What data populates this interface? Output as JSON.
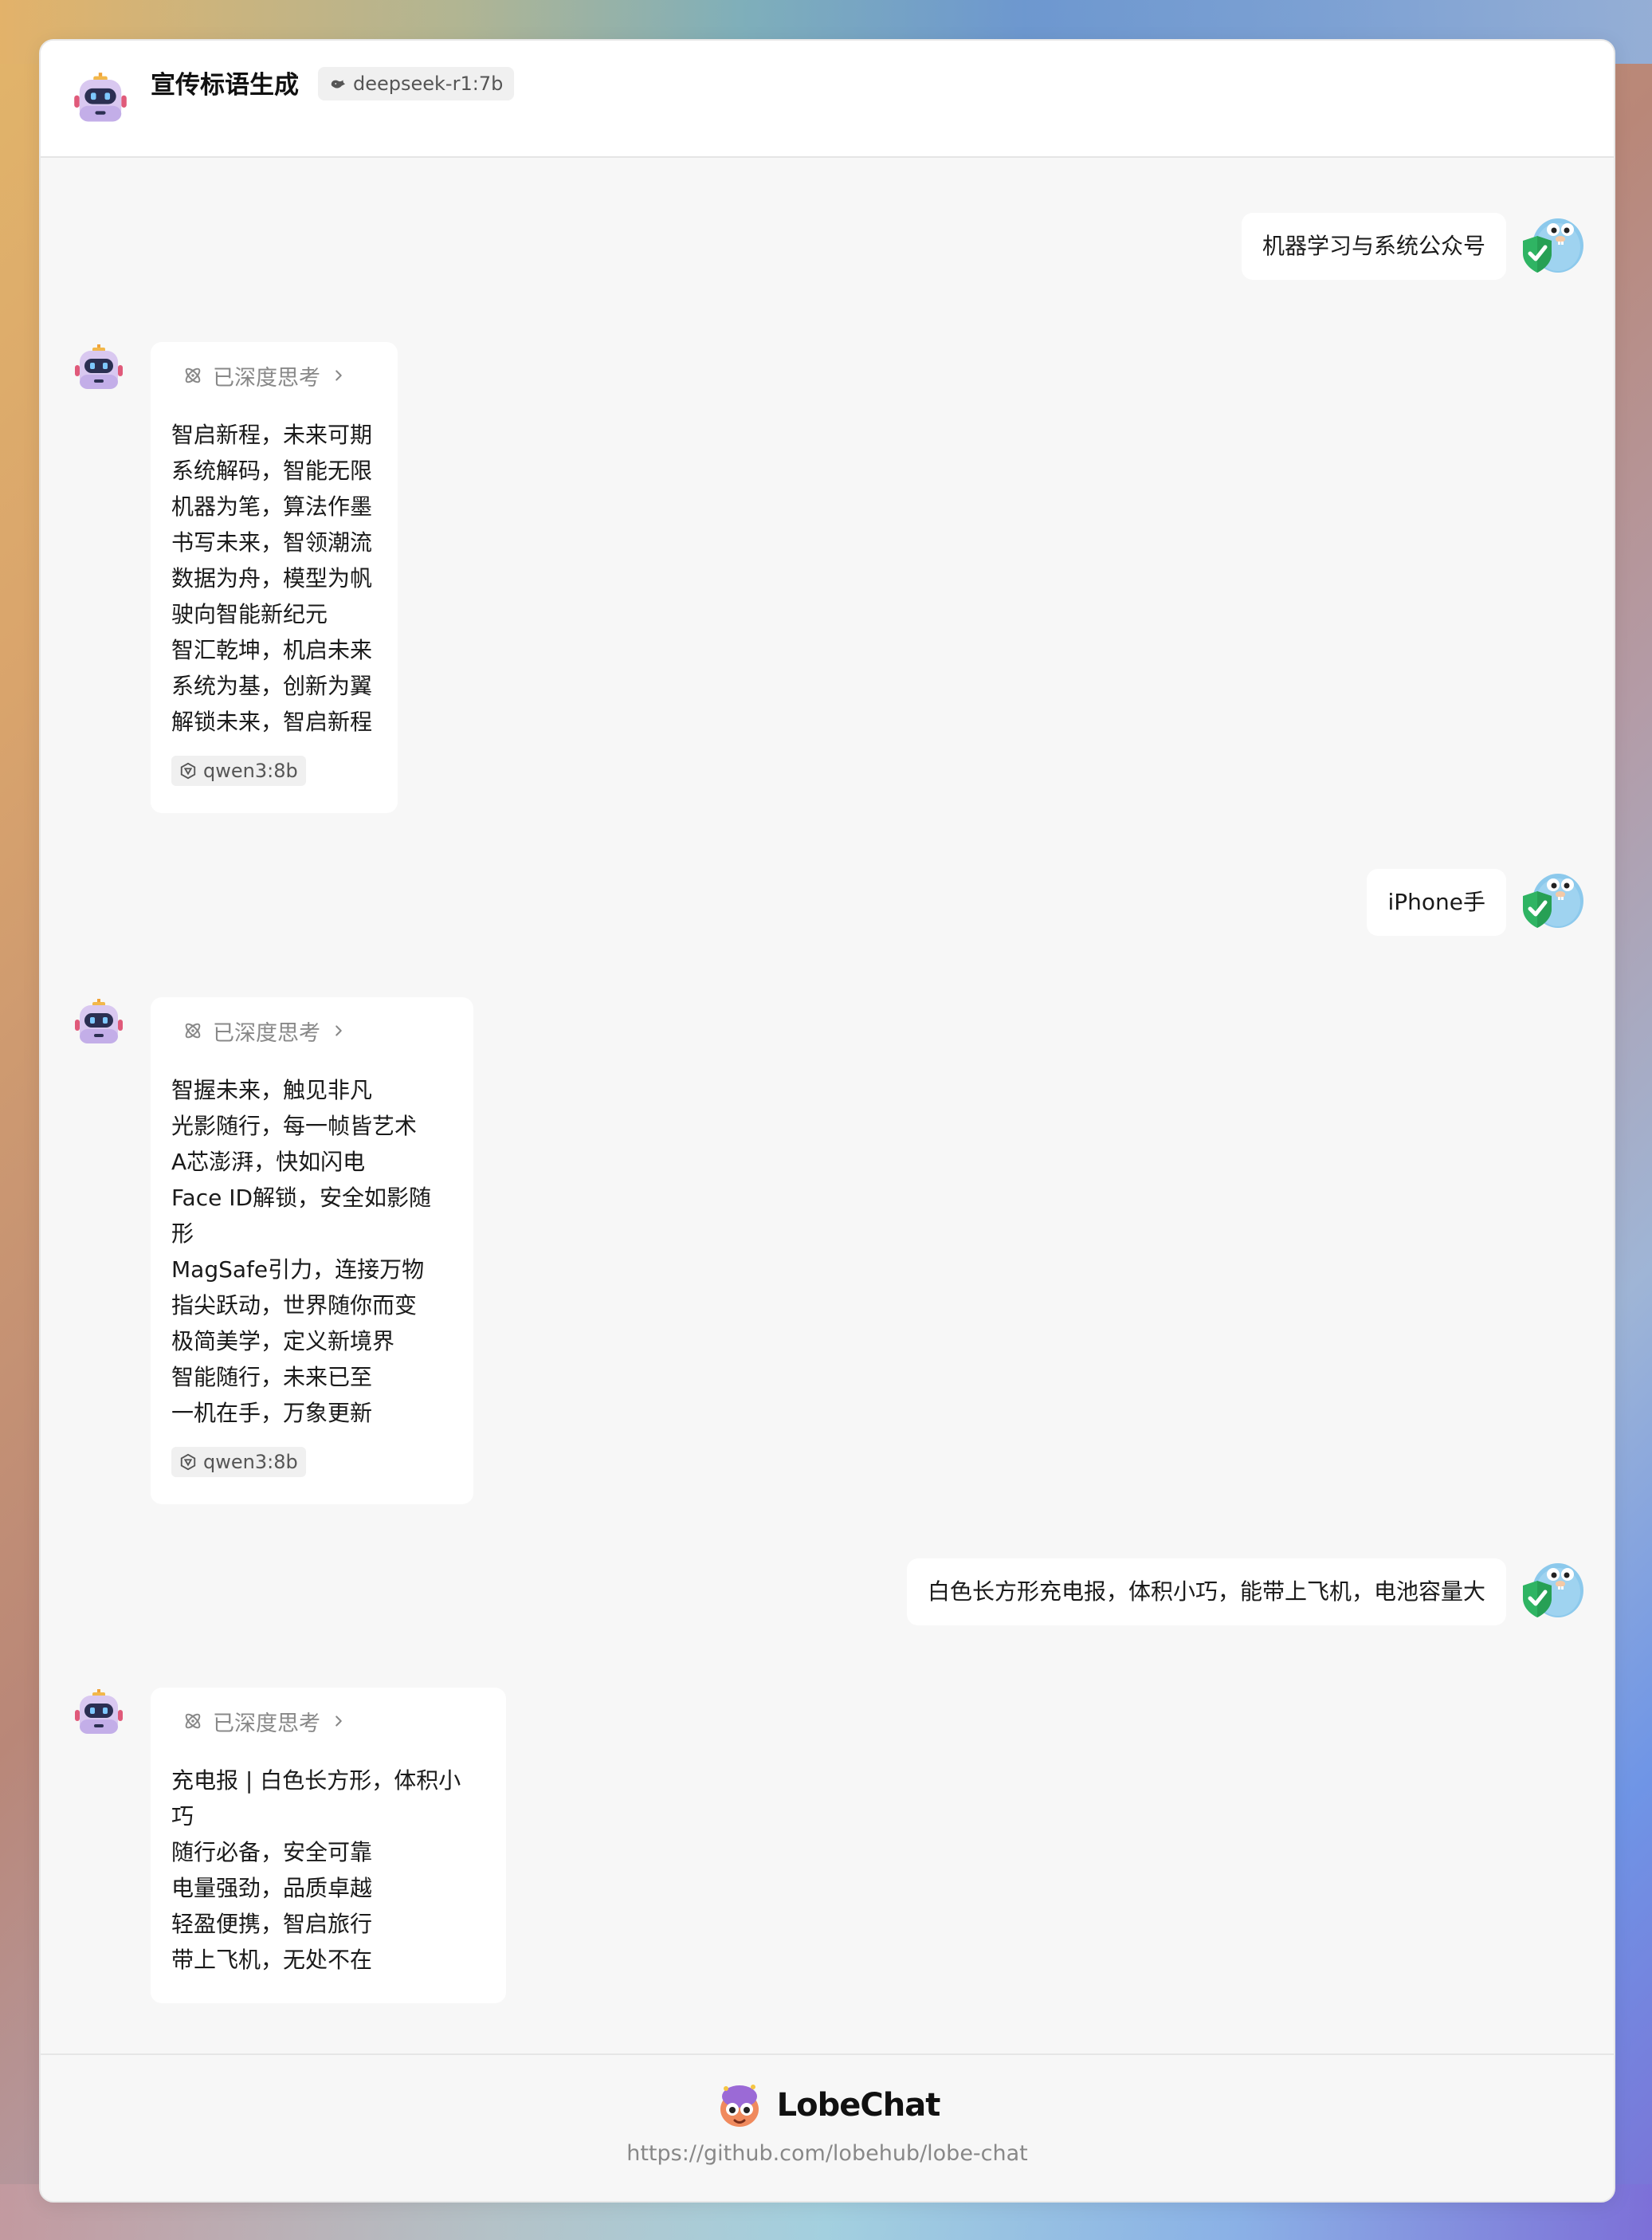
{
  "header": {
    "title": "宣传标语生成",
    "model_tag": "deepseek-r1:7b"
  },
  "messages": [
    {
      "role": "user",
      "text": "机器学习与系统公众号"
    },
    {
      "role": "assistant",
      "thinking_label": "已深度思考",
      "lines": [
        "智启新程，未来可期",
        "系统解码，智能无限",
        "机器为笔，算法作墨",
        "书写未来，智领潮流",
        "数据为舟，模型为帆",
        "驶向智能新纪元",
        "智汇乾坤，机启未来",
        "系统为基，创新为翼",
        "解锁未来，智启新程"
      ],
      "model_tag": "qwen3:8b"
    },
    {
      "role": "user",
      "text": "iPhone手"
    },
    {
      "role": "assistant",
      "thinking_label": "已深度思考",
      "lines": [
        "智握未来，触见非凡",
        "光影随行，每一帧皆艺术",
        "A芯澎湃，快如闪电",
        "Face ID解锁，安全如影随",
        "形",
        "MagSafe引力，连接万物",
        "指尖跃动，世界随你而变",
        "极简美学，定义新境界",
        "智能随行，未来已至",
        "一机在手，万象更新"
      ],
      "model_tag": "qwen3:8b"
    },
    {
      "role": "user",
      "text": "白色长方形充电报，体积小巧，能带上飞机，电池容量大"
    },
    {
      "role": "assistant",
      "thinking_label": "已深度思考",
      "lines": [
        "充电报 | 白色长方形，体积小",
        "巧",
        "随行必备，安全可靠",
        "电量强劲，品质卓越",
        "轻盈便携，智启旅行",
        "带上飞机，无处不在"
      ]
    }
  ],
  "footer": {
    "brand": "LobeChat",
    "url": "https://github.com/lobehub/lobe-chat"
  },
  "icons": {
    "bot_avatar": "robot-icon",
    "user_avatar": "gopher-shield-icon",
    "model": "whale-icon",
    "thinking": "atom-icon",
    "chevron": "chevron-right-icon",
    "qwen": "qwen-icon",
    "logo": "lobe-logo-icon"
  }
}
